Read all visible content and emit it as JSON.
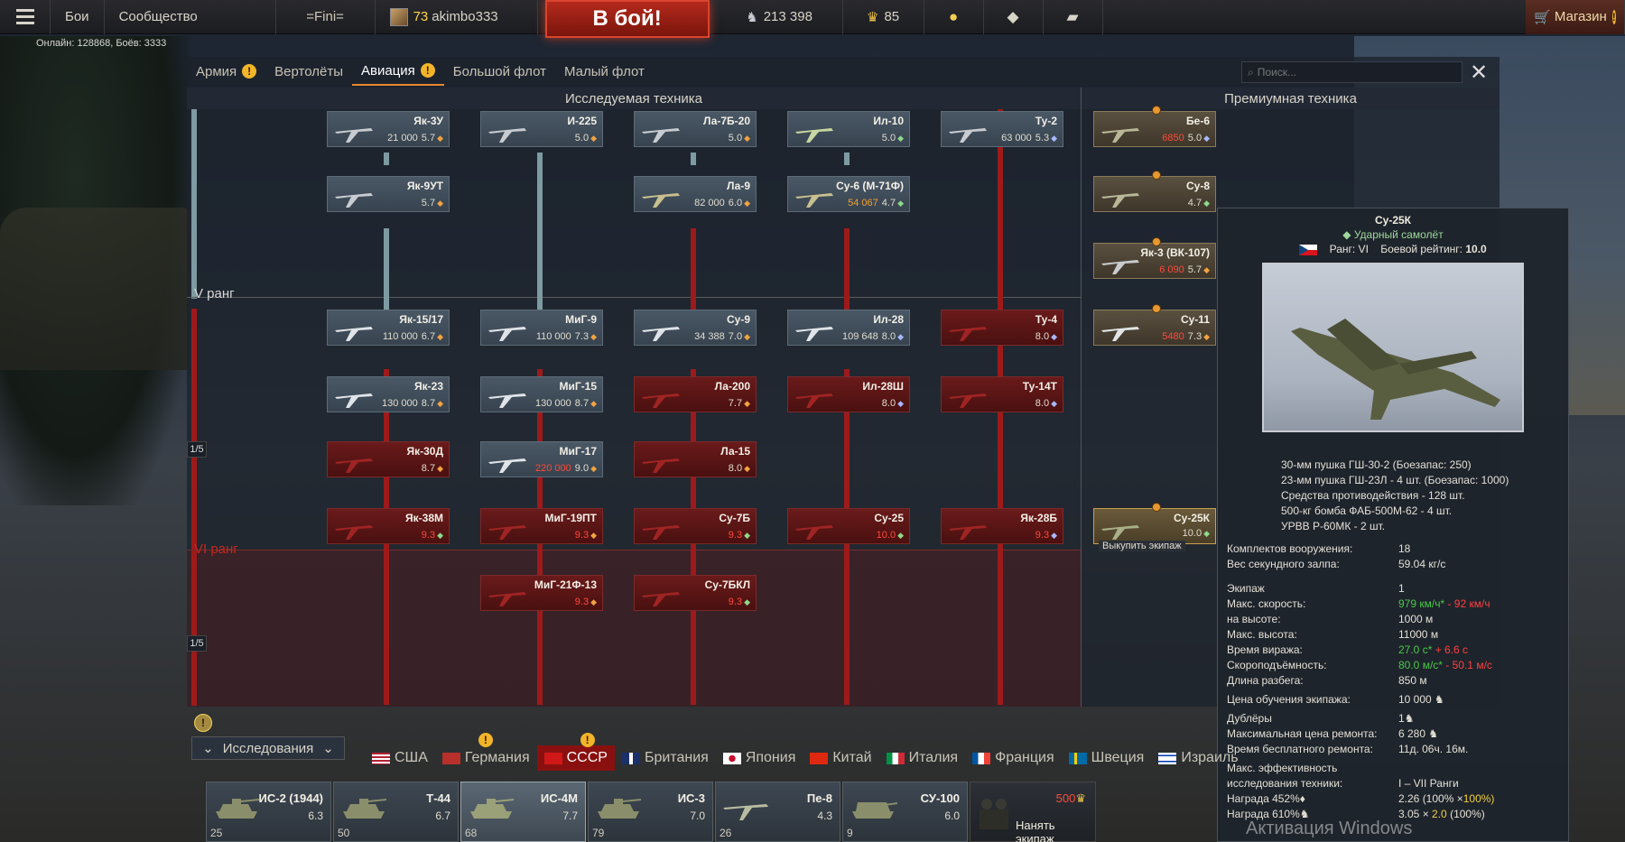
{
  "topbar": {
    "menu_icon": "hamburger-icon",
    "battles": "Бои",
    "community": "Сообщество",
    "clan_tag": "=Fini=",
    "level": "73",
    "player_name": "akimbo333",
    "to_battle": "В бой!",
    "silver_lions": "213 398",
    "golden_eagles": "85",
    "shop": "Магазин",
    "warn_mark": "!"
  },
  "online_text": "Онлайн: 128868, Боёв: 3333",
  "tabs": {
    "army": "Армия",
    "helicopters": "Вертолёты",
    "aviation": "Авиация",
    "big_fleet": "Большой флот",
    "small_fleet": "Малый флот"
  },
  "search": {
    "placeholder": "Поиск..."
  },
  "headers": {
    "researched": "Исследуемая техника",
    "premium": "Премиумная техника"
  },
  "ranks": {
    "rank5": "V ранг",
    "rank6": "VI ранг",
    "ratio": "1/5"
  },
  "cards": {
    "yak3u": {
      "name": "Як-3У",
      "cost": "21 000",
      "br": "5.7"
    },
    "i225": {
      "name": "И-225",
      "cost": "",
      "br": "5.0"
    },
    "la7b20": {
      "name": "Ла-7Б-20",
      "cost": "",
      "br": "5.0"
    },
    "il10": {
      "name": "Ил-10",
      "cost": "",
      "br": "5.0"
    },
    "tu2": {
      "name": "Ту-2",
      "cost": "63 000",
      "br": "5.3"
    },
    "yak9ut": {
      "name": "Як-9УТ",
      "cost": "",
      "br": "5.7"
    },
    "la9": {
      "name": "Ла-9",
      "cost": "82 000",
      "br": "6.0"
    },
    "su6": {
      "name": "Су-6 (М-71Ф)",
      "cost": "54 067",
      "br": "4.7"
    },
    "yak1517": {
      "name": "Як-15/17",
      "cost": "110 000",
      "br": "6.7"
    },
    "mig9": {
      "name": "МиГ-9",
      "cost": "110 000",
      "br": "7.3"
    },
    "su9": {
      "name": "Су-9",
      "cost": "34 388",
      "br": "7.0"
    },
    "il28": {
      "name": "Ил-28",
      "cost": "109 648",
      "br": "8.0"
    },
    "tu4": {
      "name": "Ту-4",
      "cost": "",
      "br": "8.0"
    },
    "yak23": {
      "name": "Як-23",
      "cost": "130 000",
      "br": "8.7"
    },
    "mig15": {
      "name": "МиГ-15",
      "cost": "130 000",
      "br": "8.7"
    },
    "la200": {
      "name": "Ла-200",
      "cost": "",
      "br": "7.7"
    },
    "il28sh": {
      "name": "Ил-28Ш",
      "cost": "",
      "br": "8.0"
    },
    "tu14t": {
      "name": "Ту-14Т",
      "cost": "",
      "br": "8.0"
    },
    "yak30d": {
      "name": "Як-30Д",
      "cost": "",
      "br": "8.7"
    },
    "mig17": {
      "name": "МиГ-17",
      "cost": "220 000",
      "br": "9.0"
    },
    "la15": {
      "name": "Ла-15",
      "cost": "",
      "br": "8.0"
    },
    "yak38m": {
      "name": "Як-38М",
      "cost": "",
      "br": "9.3"
    },
    "mig19pt": {
      "name": "МиГ-19ПТ",
      "cost": "",
      "br": "9.3"
    },
    "su7b": {
      "name": "Су-7Б",
      "cost": "",
      "br": "9.3"
    },
    "su25": {
      "name": "Су-25",
      "cost": "",
      "br": "10.0"
    },
    "yak28b": {
      "name": "Як-28Б",
      "cost": "",
      "br": "9.3"
    },
    "mig21f13": {
      "name": "МиГ-21Ф-13",
      "cost": "",
      "br": "9.3"
    },
    "su7bkl": {
      "name": "Су-7БКЛ",
      "cost": "",
      "br": "9.3"
    },
    "be6": {
      "name": "Бе-6",
      "cost": "6850",
      "br": "5.0"
    },
    "su8": {
      "name": "Су-8",
      "cost": "",
      "br": "4.7"
    },
    "yak3vk107": {
      "name": "Як-3 (ВК-107)",
      "cost": "6 090",
      "br": "5.7"
    },
    "su11": {
      "name": "Су-11",
      "cost": "5480",
      "br": "7.3"
    },
    "su25k": {
      "name": "Су-25К",
      "cost": "",
      "br": "10.0",
      "hover": "Выкупить экипаж"
    }
  },
  "tooltip": {
    "name": "Су-25К",
    "class": "Ударный самолёт",
    "rank_label": "Ранг: VI",
    "rating_label": "Боевой рейтинг:",
    "rating_value": "10.0",
    "armament": [
      "30-мм пушка ГШ-30-2 (Боезапас: 250)",
      "23-мм пушка ГШ-23Л - 4 шт. (Боезапас: 1000)",
      "Средства противодействия - 128 шт.",
      "500-кг бомба ФАБ-500М-62 - 4 шт.",
      "УРВВ Р-60МК - 2 шт."
    ],
    "presets_label": "Комплектов вооружения:",
    "presets_value": "18",
    "salvo_label": "Вес секундного залпа:",
    "salvo_value": "59.04 кг/с",
    "crew_label": "Экипаж",
    "crew_value": "1",
    "speed_label": "Макс. скорость:",
    "speed_value": "979 км/ч*",
    "speed_diff": "- 92 км/ч",
    "alt_label": "на высоте:",
    "alt_value": "1000 м",
    "ceiling_label": "Макс. высота:",
    "ceiling_value": "11000 м",
    "turn_label": "Время виража:",
    "turn_value": "27.0 с*",
    "turn_diff": "+ 6.6 с",
    "climb_label": "Скороподъёмность:",
    "climb_value": "80.0 м/с*",
    "climb_diff": "- 50.1 м/с",
    "takeoff_label": "Длина разбега:",
    "takeoff_value": "850 м",
    "crew_train_label": "Цена обучения экипажа:",
    "crew_train_value": "10 000",
    "backups_label": "Дублёры",
    "backups_value": "1",
    "repair_label": "Максимальная цена ремонта:",
    "repair_value": "6 280",
    "free_repair_label": "Время бесплатного ремонта:",
    "free_repair_value": "11д. 06ч. 16м.",
    "research_eff_label": "Макс. эффективность",
    "research_eff_label2": "исследования техники:",
    "research_eff_value": "I – VII Ранги",
    "reward_rp_label": "Награда 452%",
    "reward_rp_value": "2.26 (100% ×",
    "reward_rp_value2": "100%)",
    "reward_sl_label": "Награда 610%",
    "reward_sl_value": "3.05 ×",
    "reward_sl_value2": "2.0",
    "reward_sl_value3": "(100%)"
  },
  "watermark": "Активация Windows",
  "bottom": {
    "research": "Исследования",
    "nations": [
      "США",
      "Германия",
      "СССР",
      "Британия",
      "Япония",
      "Китай",
      "Италия",
      "Франция",
      "Швеция",
      "Израиль"
    ],
    "slots": [
      {
        "name": "ИС-2 (1944)",
        "br": "6.3",
        "crew": "25"
      },
      {
        "name": "Т-44",
        "br": "6.7",
        "crew": "50"
      },
      {
        "name": "ИС-4М",
        "br": "7.7",
        "crew": "68"
      },
      {
        "name": "ИС-3",
        "br": "7.0",
        "crew": "79"
      },
      {
        "name": "Пе-8",
        "br": "4.3",
        "crew": "26"
      },
      {
        "name": "СУ-100",
        "br": "6.0",
        "crew": "9"
      }
    ],
    "hire_price": "500",
    "hire_label": "Нанять экипаж"
  }
}
